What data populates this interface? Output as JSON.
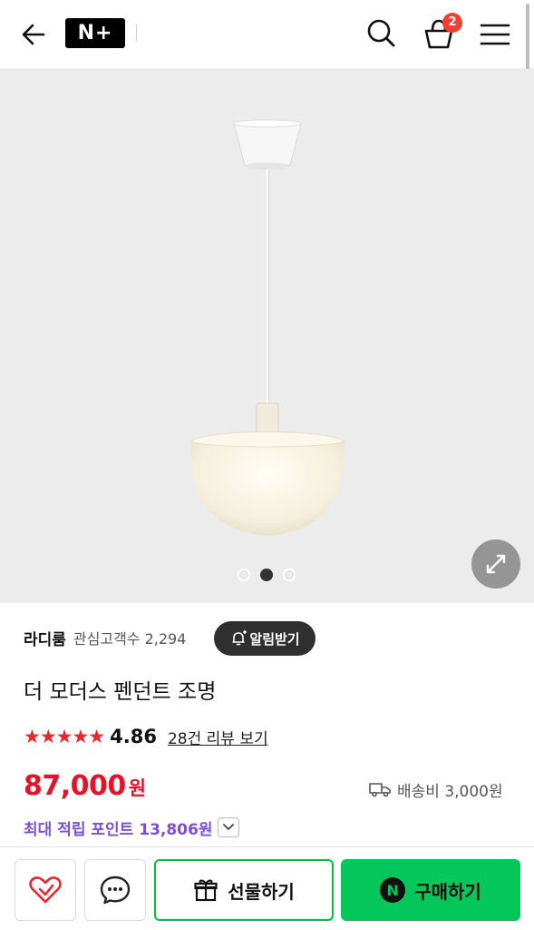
{
  "header": {
    "logo_text": "N+",
    "cart_count": "2",
    "icons": [
      "back-arrow-icon",
      "search-icon",
      "cart-icon",
      "menu-icon"
    ]
  },
  "gallery": {
    "current_index": 2,
    "total_images": 3
  },
  "seller": {
    "name": "라디룸",
    "fans_label": "관심고객수 2,294",
    "alarm_label": "알림받기"
  },
  "product": {
    "title": "더 모더스 펜던트 조명",
    "stars": "★★★★★",
    "rating": "4.86",
    "review_link": "28건 리뷰 보기",
    "price": "87,000",
    "currency": "원",
    "shipping": "배송비 3,000원",
    "points": "최대 적립 포인트 13,806원"
  },
  "actions": {
    "gift_label": "선물하기",
    "buy_label": "구매하기",
    "buy_logo": "N"
  },
  "colors": {
    "price_red": "#e5132a",
    "naver_green": "#03c75a",
    "points_purple": "#7b4fd6",
    "badge_red": "#f0412f"
  }
}
